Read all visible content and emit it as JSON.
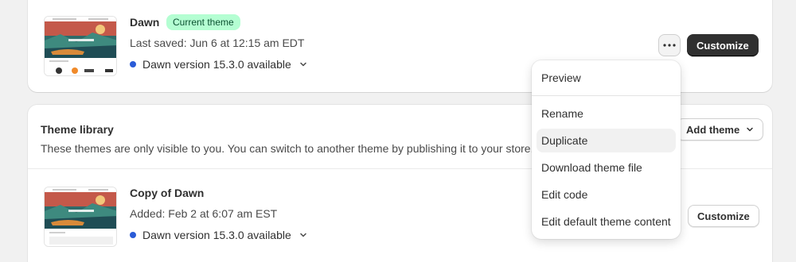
{
  "current": {
    "name": "Dawn",
    "badge": "Current theme",
    "saved": "Last saved: Jun 6 at 12:15 am EDT",
    "version": "Dawn version 15.3.0 available",
    "customize_label": "Customize"
  },
  "library": {
    "title": "Theme library",
    "description": "These themes are only visible to you. You can switch to another theme by publishing it to your store.",
    "add_theme_label": "Add theme",
    "themes": [
      {
        "name": "Copy of Dawn",
        "added": "Added: Feb 2 at 6:07 am EST",
        "version": "Dawn version 15.3.0 available",
        "customize_label": "Customize"
      }
    ]
  },
  "menu": {
    "items": [
      "Preview",
      "Rename",
      "Duplicate",
      "Download theme file",
      "Edit code",
      "Edit default theme content"
    ],
    "hovered": "Duplicate"
  },
  "colors": {
    "badge_bg": "#b4fed2",
    "badge_text": "#0c5132",
    "version_dot": "#2a5bd7",
    "primary_button": "#303030"
  },
  "icons": {
    "more": "horizontal-dots-icon",
    "chevron": "chevron-down-icon"
  }
}
